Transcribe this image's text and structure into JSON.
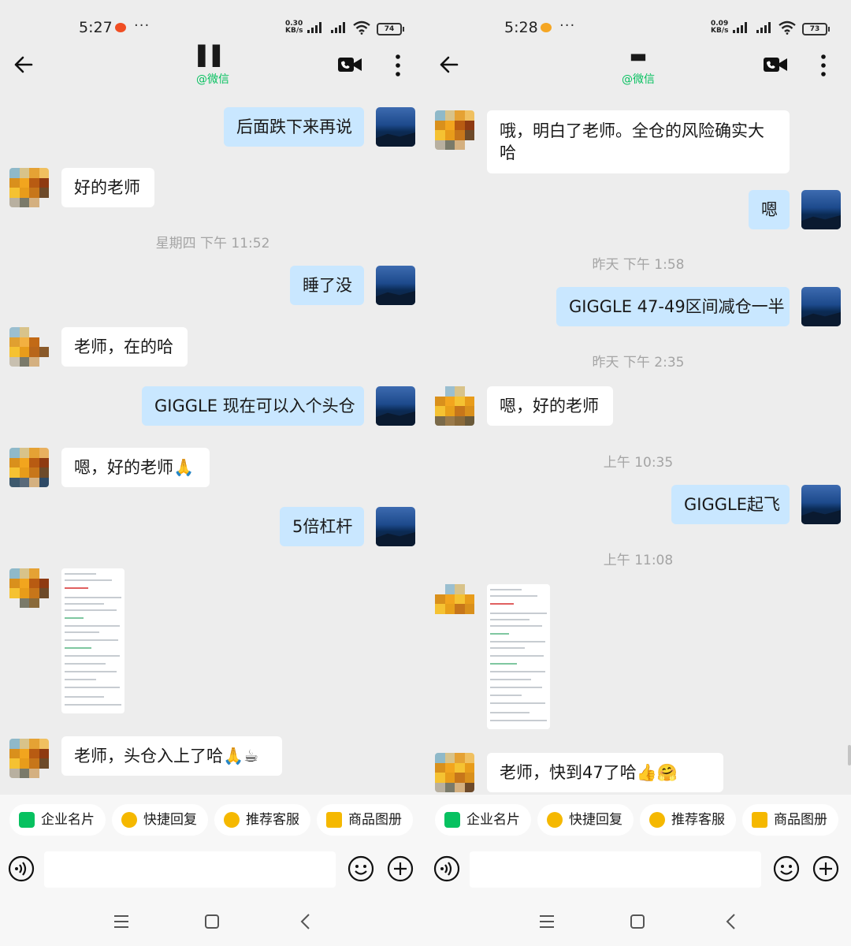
{
  "left": {
    "status": {
      "time": "5:27",
      "more": "···",
      "speed_top": "0.30",
      "speed_bottom": "KB/s",
      "battery": "74"
    },
    "header": {
      "title": "▌▌",
      "subtitle": "@微信"
    },
    "timestamps": [
      "星期四 下午 11:52"
    ],
    "messages": {
      "m1": "后面跌下来再说",
      "m2": "好的老师",
      "m3": "睡了没",
      "m4": "老师，在的哈",
      "m5": "GIGGLE 现在可以入个头仓",
      "m6": "嗯，好的老师🙏",
      "m7": "5倍杠杆",
      "m8": "老师，头仓入上了哈🙏☕"
    },
    "quick": [
      "企业名片",
      "快捷回复",
      "推荐客服",
      "商品图册"
    ]
  },
  "right": {
    "status": {
      "time": "5:28",
      "more": "···",
      "speed_top": "0.09",
      "speed_bottom": "KB/s",
      "battery": "73"
    },
    "header": {
      "title": "▬",
      "subtitle": "@微信"
    },
    "timestamps": [
      "昨天 下午 1:58",
      "昨天 下午 2:35",
      "上午 10:35",
      "上午 11:08"
    ],
    "messages": {
      "m1": "哦，明白了老师。全仓的风险确实大哈",
      "m2": "嗯",
      "m3": "GIGGLE 47-49区间减仓一半",
      "m4": "嗯，好的老师",
      "m5": "GIGGLE起飞",
      "m6": "老师，快到47了哈👍🤗"
    },
    "quick": [
      "企业名片",
      "快捷回复",
      "推荐客服",
      "商品图册"
    ]
  },
  "colors": {
    "my_bubble": "#c9e7ff",
    "their_bubble": "#ffffff",
    "wechat_green": "#07c160",
    "background": "#ededed"
  }
}
